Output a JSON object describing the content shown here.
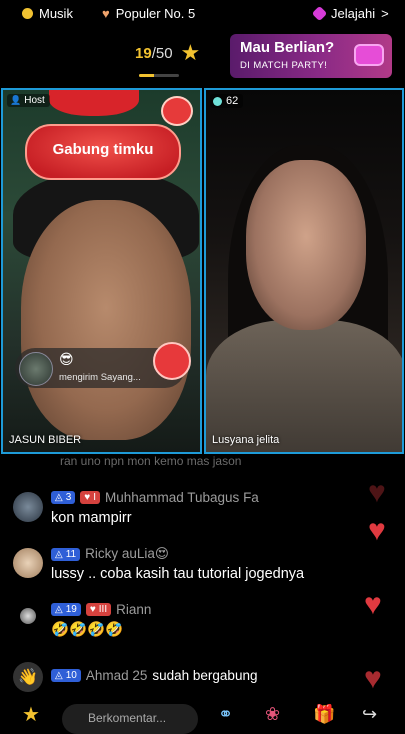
{
  "topbar": {
    "item1": {
      "label": "Musik",
      "icon": "music-coin-icon",
      "color": "#f1c232"
    },
    "item2": {
      "label": "Populer No. 5",
      "icon": "heart-badge-icon",
      "color": "#f0a36c"
    },
    "item3": {
      "label": "Jelajahi",
      "icon": "gem-icon",
      "color": "#d63bd8"
    },
    "item3_chevron": ">"
  },
  "progress": {
    "current": "19",
    "total": "/50",
    "fill": 0.38,
    "icon": "star-icon",
    "accent": "#f2c230"
  },
  "promo": {
    "title": "Mau Berlian?",
    "subtitle": "DI MATCH PARTY!"
  },
  "tiles": {
    "left": {
      "badge": "Host",
      "banner": "Gabung timku",
      "name": "JASUN BIBER",
      "gift": {
        "emoji": "😎",
        "text": "mengirim Sayang..."
      }
    },
    "right": {
      "viewers": "62",
      "name": "Lusyana jelita"
    }
  },
  "chat": {
    "faded_line": "ran uno npn mon kemo mas jason",
    "messages": [
      {
        "level": "3",
        "fan_level": "I",
        "user": "Muhhammad Tubagus Fa",
        "text": "kon mampirr"
      },
      {
        "level": "11",
        "user": "Ricky auLia😍",
        "text": "lussy .. coba kasih tau tutorial jogednya"
      },
      {
        "level": "19",
        "fan_level": "III",
        "user": "Riann",
        "text": "🤣🤣🤣🤣"
      },
      {
        "level": "10",
        "user": "Ahmad 25",
        "text": "sudah bergabung"
      }
    ]
  },
  "bottom": {
    "comment_placeholder": "Berkomentar..."
  },
  "colors": {
    "tile_border": "#1e9bd8",
    "heart": "#e03a40",
    "level_badge": "#2f5fd7",
    "fan_badge": "#d5423e"
  }
}
